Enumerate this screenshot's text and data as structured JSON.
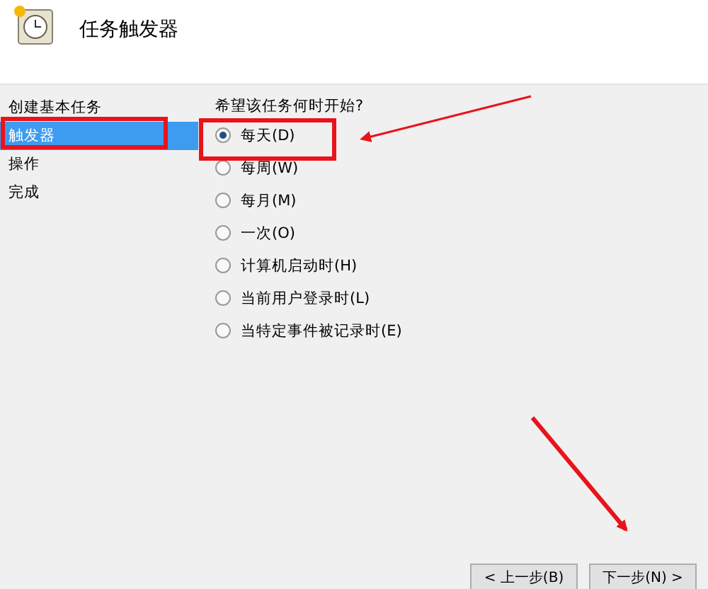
{
  "window": {
    "title": "任务触发器"
  },
  "sidebar": {
    "items": [
      {
        "label": "创建基本任务",
        "selected": false
      },
      {
        "label": "触发器",
        "selected": true
      },
      {
        "label": "操作",
        "selected": false
      },
      {
        "label": "完成",
        "selected": false
      }
    ]
  },
  "question": "希望该任务何时开始?",
  "options": [
    {
      "label": "每天(D)",
      "selected": true
    },
    {
      "label": "每周(W)",
      "selected": false
    },
    {
      "label": "每月(M)",
      "selected": false
    },
    {
      "label": "一次(O)",
      "selected": false
    },
    {
      "label": "计算机启动时(H)",
      "selected": false
    },
    {
      "label": "当前用户登录时(L)",
      "selected": false
    },
    {
      "label": "当特定事件被记录时(E)",
      "selected": false
    }
  ],
  "buttons": [
    "< 上一步(B)",
    "下一步(N) >"
  ]
}
